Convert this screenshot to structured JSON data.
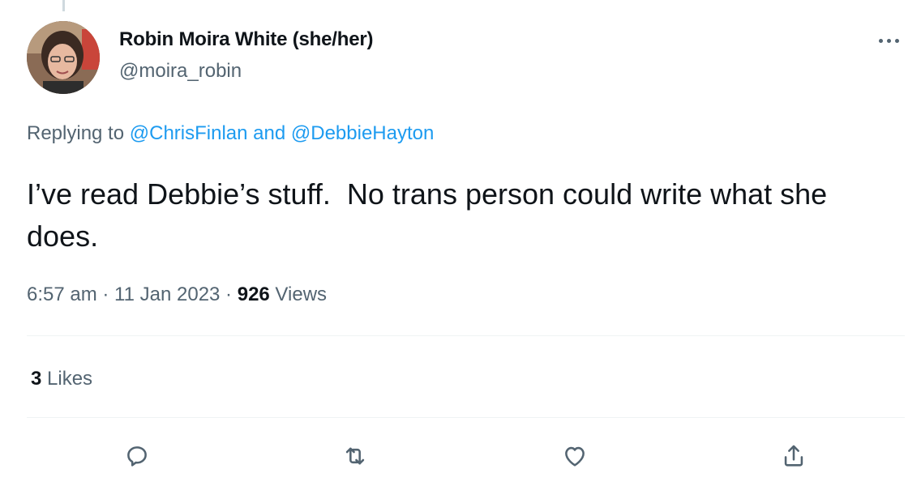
{
  "author": {
    "display_name": "Robin Moira White (she/her)",
    "handle": "@moira_robin",
    "avatar_icon": "avatar"
  },
  "reply_context": {
    "prefix": "Replying to ",
    "mention_1": "@ChrisFinlan",
    "joiner": " and ",
    "mention_2": "@DebbieHayton"
  },
  "tweet": {
    "text": "I’ve read Debbie’s stuff.  No trans person could write what she does."
  },
  "meta": {
    "time": "6:57 am",
    "sep1": " · ",
    "date": "11 Jan 2023",
    "sep2": " · ",
    "views_count": "926",
    "views_label": " Views"
  },
  "engagement": {
    "likes_count": "3",
    "likes_label": " Likes"
  },
  "actions": [
    {
      "name": "reply",
      "icon": "reply-icon"
    },
    {
      "name": "retweet",
      "icon": "retweet-icon"
    },
    {
      "name": "like",
      "icon": "heart-icon"
    },
    {
      "name": "share",
      "icon": "share-icon"
    }
  ],
  "colors": {
    "text_primary": "#0f1419",
    "text_secondary": "#536471",
    "link": "#1d9bf0",
    "divider": "#eff3f4"
  }
}
